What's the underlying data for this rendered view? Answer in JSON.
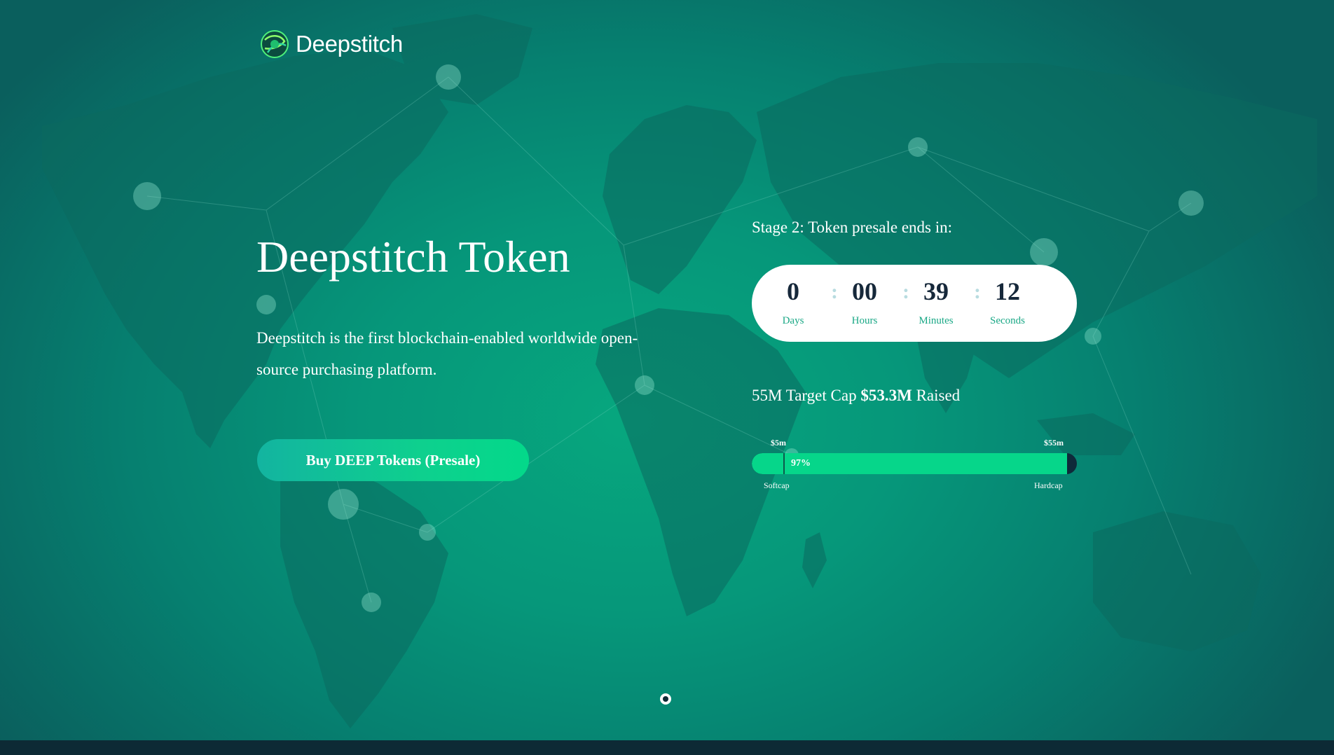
{
  "brand": {
    "name": "Deepstitch",
    "logo_icon": "globe-orb-icon"
  },
  "hero": {
    "title": "Deepstitch Token",
    "description": "Deepstitch is the first blockchain-enabled worldwide open-source purchasing platform.",
    "buy_button_label": "Buy DEEP Tokens (Presale)"
  },
  "presale": {
    "stage_label": "Stage 2: Token presale ends in:",
    "countdown": [
      {
        "value": "0",
        "label": "Days"
      },
      {
        "value": "00",
        "label": "Hours"
      },
      {
        "value": "39",
        "label": "Minutes"
      },
      {
        "value": "12",
        "label": "Seconds"
      }
    ],
    "separator": ":",
    "cap_prefix": "55M Target Cap",
    "cap_raised": "$53.3M",
    "cap_suffix": "Raised",
    "progress": {
      "percent": 97,
      "percent_label": "97%",
      "softcap_value": "$5m",
      "hardcap_value": "$55m",
      "softcap_label": "Softcap",
      "hardcap_label": "Hardcap"
    }
  },
  "carousel": {
    "active_index": 0,
    "count": 1
  },
  "colors": {
    "accent": "#06d68a",
    "background_start": "#07a77e",
    "background_end": "#0a5f5d",
    "dark": "#0d2a35"
  }
}
